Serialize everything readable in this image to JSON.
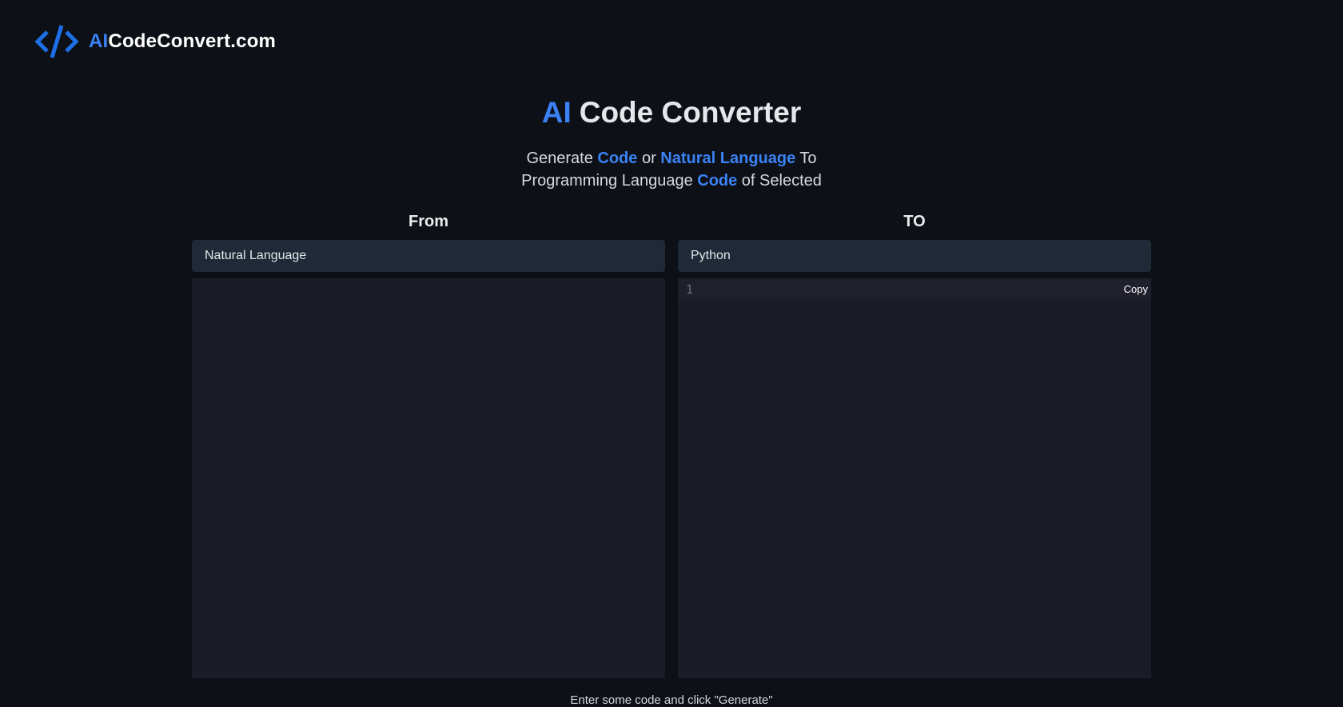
{
  "header": {
    "brand_prefix": "AI",
    "brand_rest": "CodeConvert.com",
    "logo_icon": "code-brackets-icon",
    "accent_color": "#3b82f6"
  },
  "hero": {
    "title_accent": "AI",
    "title_rest": "Code Converter",
    "subtitle": {
      "part1": "Generate ",
      "hl1": "Code",
      "part2": " or ",
      "hl2": "Natural Language",
      "part3": " To",
      "part4": "Programming Language ",
      "hl3": "Code",
      "part5": " of Selected"
    }
  },
  "from": {
    "label": "From",
    "selected": "Natural Language"
  },
  "to": {
    "label": "TO",
    "selected": "Python",
    "line_number": "1",
    "copy_label": "Copy"
  },
  "footer": {
    "hint": "Enter some code and click \"Generate\""
  }
}
